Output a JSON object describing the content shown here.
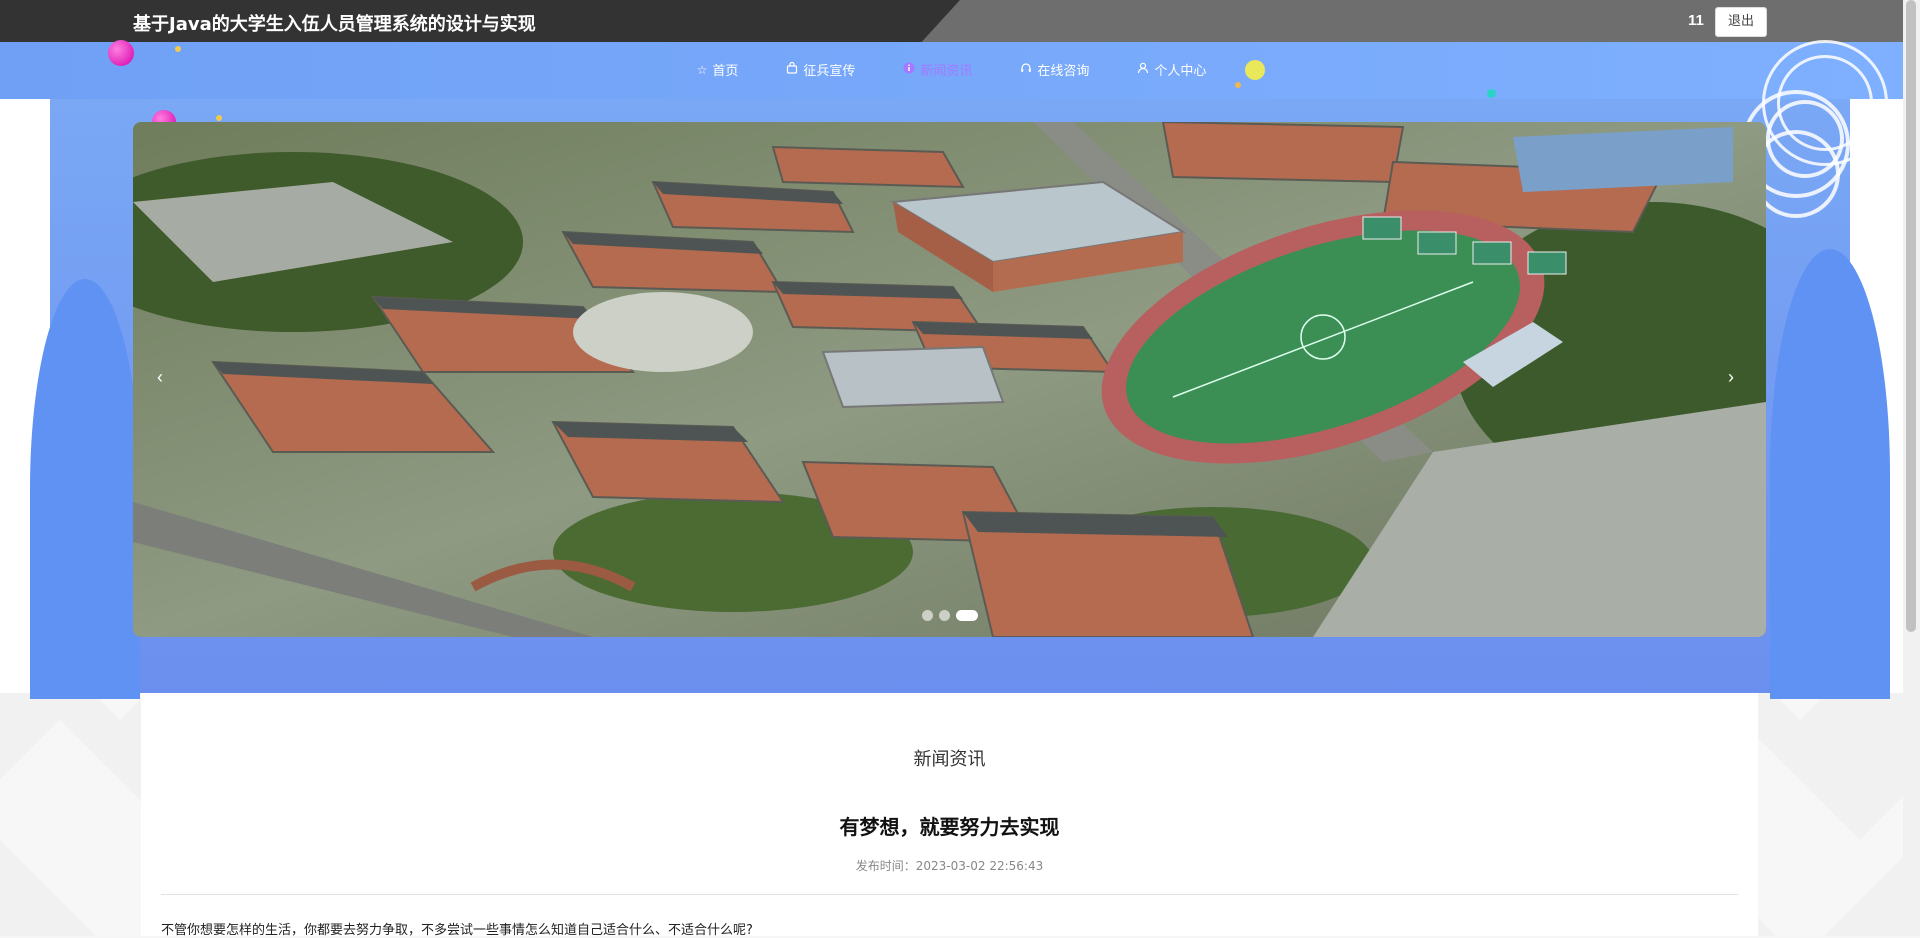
{
  "header": {
    "site_title": "基于Java的大学生入伍人员管理系统的设计与实现",
    "user_name": "11",
    "logout_label": "退出"
  },
  "nav": {
    "items": [
      {
        "label": "首页",
        "icon": "star-icon"
      },
      {
        "label": "征兵宣传",
        "icon": "bag-icon"
      },
      {
        "label": "新闻资讯",
        "icon": "info-icon",
        "active": true
      },
      {
        "label": "在线咨询",
        "icon": "headset-icon"
      },
      {
        "label": "个人中心",
        "icon": "user-icon"
      }
    ],
    "active_color": "#a678ff"
  },
  "carousel": {
    "prev_label": "‹",
    "next_label": "›",
    "slide_count": 3,
    "active_index": 2
  },
  "content": {
    "section_title": "新闻资讯",
    "article_title": "有梦想，就要努力去实现",
    "publish_time": "发布时间：2023-03-02 22:56:43",
    "body_first_line": "不管你想要怎样的生活，你都要去努力争取，不多尝试一些事情怎么知道自己适合什么、不适合什么呢?"
  },
  "colors": {
    "hero_blue": "#6b8fee",
    "topbar_dark": "#333333"
  }
}
